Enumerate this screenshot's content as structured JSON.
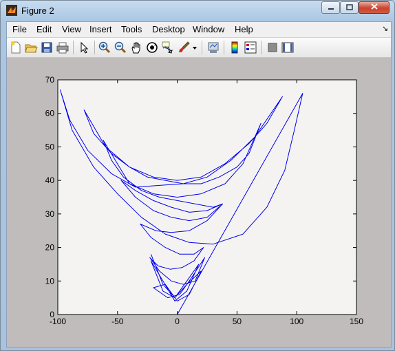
{
  "window": {
    "title": "Figure 2"
  },
  "menubar": {
    "items": [
      "File",
      "Edit",
      "View",
      "Insert",
      "Tools",
      "Desktop",
      "Window",
      "Help"
    ]
  },
  "toolbar": {
    "icons": [
      "new-figure-icon",
      "open-file-icon",
      "save-icon",
      "print-icon",
      "edit-plot-arrow-icon",
      "zoom-in-icon",
      "zoom-out-icon",
      "pan-icon",
      "rotate-3d-icon",
      "data-cursor-icon",
      "brush-icon",
      "brush-dropdown-icon",
      "link-plot-icon",
      "colorbar-icon",
      "legend-icon",
      "hide-plot-tools-icon",
      "show-plot-tools-icon"
    ]
  },
  "colors": {
    "line": "#0000ee",
    "axes_bg": "#f4f3f2",
    "figure_bg": "#c0bcbb"
  },
  "chart_data": {
    "type": "line",
    "title": "",
    "xlabel": "",
    "ylabel": "",
    "xlim": [
      -100,
      150
    ],
    "ylim": [
      0,
      70
    ],
    "xticks": [
      -100,
      -50,
      0,
      50,
      100,
      150
    ],
    "yticks": [
      0,
      10,
      20,
      30,
      40,
      50,
      60,
      70
    ],
    "grid": false,
    "series": [
      {
        "name": "",
        "x": [
          0,
          105,
          98,
          90,
          75,
          55,
          30,
          10,
          -10,
          -30,
          -50,
          -70,
          -88,
          -98,
          -90,
          -75,
          -55,
          -35,
          -15,
          5,
          25,
          45,
          65,
          88,
          75,
          60,
          40,
          20,
          0,
          -20,
          -40,
          -60,
          -78,
          -70,
          -55,
          -40,
          -25,
          -10,
          5,
          20,
          35,
          50,
          60,
          70,
          55,
          40,
          20,
          0,
          -20,
          -40,
          -62,
          -55,
          -45,
          -30,
          -15,
          0,
          15,
          30,
          38,
          25,
          10,
          -5,
          -20,
          -35,
          -47,
          -35,
          -20,
          -5,
          10,
          25,
          38,
          25,
          10,
          -5,
          -18,
          -31,
          -22,
          -10,
          2,
          14,
          22,
          14,
          4,
          -6,
          -16,
          -23,
          -15,
          -5,
          5,
          15,
          23,
          12,
          2,
          -8,
          -20,
          -10,
          0,
          10,
          20,
          8,
          -2,
          -12,
          -22,
          -12,
          -2,
          8,
          18,
          8,
          -2,
          -12,
          -22
        ],
        "y": [
          0,
          66,
          55,
          43,
          32,
          24,
          21,
          21.5,
          24,
          29,
          36,
          44,
          55,
          67,
          58,
          49,
          42,
          38,
          38.5,
          39,
          41,
          46,
          53,
          65,
          57,
          51,
          45,
          41,
          40,
          41,
          44,
          50,
          61,
          54,
          48,
          44,
          41,
          40,
          39,
          39,
          41,
          44,
          48,
          57,
          45,
          39,
          36,
          35,
          36,
          39,
          52,
          46,
          41,
          37,
          35,
          34,
          33,
          32,
          33,
          31,
          30.5,
          32,
          34,
          37,
          40,
          35,
          31,
          29,
          28,
          29,
          33,
          28,
          25,
          24.5,
          25,
          27,
          23,
          20,
          18,
          18,
          20,
          16,
          14,
          13.5,
          14.5,
          17,
          13,
          10,
          9,
          10,
          17,
          11,
          6,
          5,
          8,
          9,
          4,
          6,
          13,
          9,
          5,
          7,
          16,
          10,
          4,
          7,
          15,
          10,
          5,
          9,
          18
        ]
      }
    ]
  }
}
